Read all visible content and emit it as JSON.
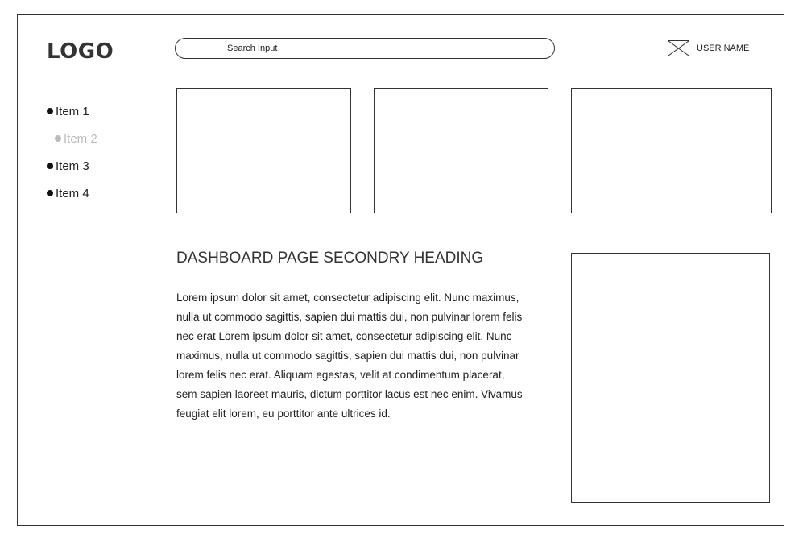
{
  "header": {
    "logo": "LOGO",
    "search_placeholder": "Search Input",
    "user_name": "USER NAME"
  },
  "sidebar": {
    "items": [
      {
        "label": "Item 1",
        "state": "normal"
      },
      {
        "label": "Item 2",
        "state": "disabled"
      },
      {
        "label": "Item 3",
        "state": "normal"
      },
      {
        "label": "Item 4",
        "state": "normal"
      }
    ]
  },
  "main": {
    "heading": "DASHBOARD PAGE SECONDRY HEADING",
    "body": "Lorem ipsum dolor sit amet, consectetur adipiscing elit. Nunc maximus, nulla ut commodo sagittis, sapien dui mattis dui, non pulvinar lorem felis nec erat Lorem ipsum dolor sit amet, consectetur adipiscing elit. Nunc maximus, nulla ut commodo sagittis, sapien dui mattis dui, non pulvinar lorem felis nec erat. Aliquam egestas, velit at condimentum placerat, sem sapien laoreet mauris, dictum porttitor lacus est nec enim. Vivamus feugiat elit lorem, eu porttitor ante ultrices id."
  },
  "icons": {
    "avatar": "image-placeholder-icon"
  },
  "colors": {
    "line": "#333333",
    "disabled": "#bbbbbb",
    "background": "#ffffff"
  }
}
